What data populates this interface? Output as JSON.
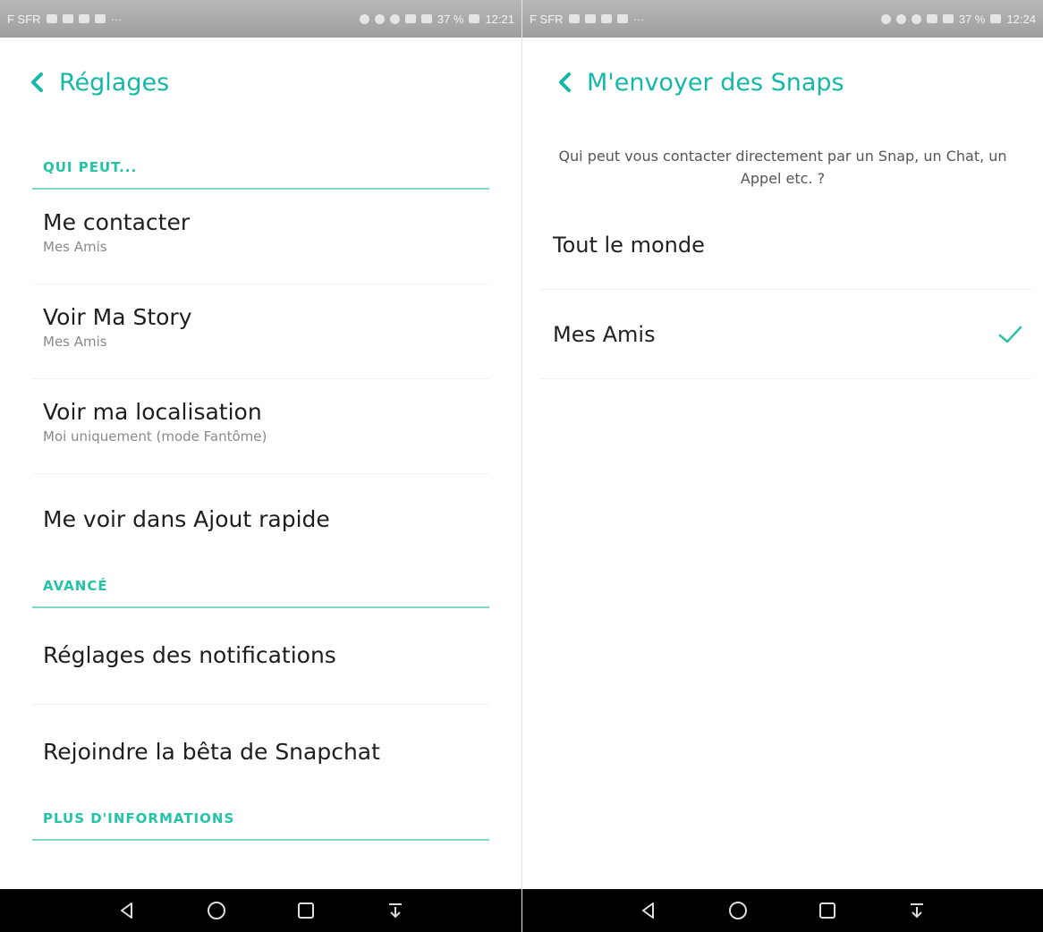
{
  "left": {
    "status": {
      "carrier": "F SFR",
      "battery": "37 %",
      "time": "12:21"
    },
    "header": {
      "title": "Réglages"
    },
    "sections": {
      "who_can": {
        "title": "QUI PEUT...",
        "items": [
          {
            "label": "Me contacter",
            "sub": "Mes Amis"
          },
          {
            "label": "Voir Ma Story",
            "sub": "Mes Amis"
          },
          {
            "label": "Voir ma localisation",
            "sub": "Moi uniquement (mode Fantôme)"
          },
          {
            "label": "Me voir dans Ajout rapide"
          }
        ]
      },
      "advanced": {
        "title": "AVANCÉ",
        "items": [
          {
            "label": "Réglages des notifications"
          },
          {
            "label": "Rejoindre la bêta de Snapchat"
          }
        ]
      },
      "more": {
        "title": "PLUS D'INFORMATIONS"
      }
    }
  },
  "right": {
    "status": {
      "carrier": "F SFR",
      "battery": "37 %",
      "time": "12:24"
    },
    "header": {
      "title": "M'envoyer des Snaps"
    },
    "description": "Qui peut vous contacter directement par un Snap, un Chat, un Appel etc. ?",
    "options": [
      {
        "label": "Tout le monde",
        "selected": false
      },
      {
        "label": "Mes Amis",
        "selected": true
      }
    ]
  },
  "colors": {
    "accent": "#14b8a6",
    "divider": "#7fd9c9",
    "navbar": "#000000"
  },
  "icons": {
    "back": "chevron-left-icon",
    "check": "check-icon",
    "nav": [
      "back-triangle-icon",
      "home-circle-icon",
      "recents-square-icon",
      "notification-drawer-icon"
    ]
  }
}
